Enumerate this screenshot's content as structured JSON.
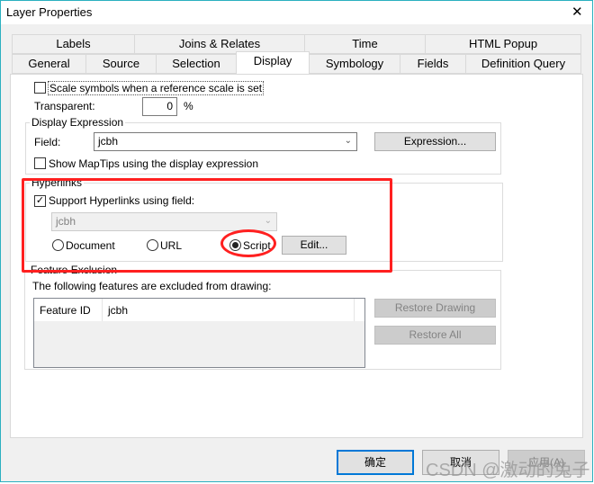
{
  "window": {
    "title": "Layer Properties",
    "close": "✕"
  },
  "tabs_row1": [
    "Labels",
    "Joins & Relates",
    "Time",
    "HTML Popup"
  ],
  "tabs_row2": [
    "General",
    "Source",
    "Selection",
    "Display",
    "Symbology",
    "Fields",
    "Definition Query"
  ],
  "active_tab": "Display",
  "display": {
    "scale_symbols": {
      "label": "Scale symbols when a reference scale is set",
      "checked": false
    },
    "transparent": {
      "label": "Transparent:",
      "value": "0",
      "unit": "%"
    },
    "display_expression": {
      "title": "Display Expression",
      "field_label": "Field:",
      "field_value": "jcbh",
      "expression_button": "Expression...",
      "maptips": {
        "label": "Show MapTips using the display expression",
        "checked": false
      }
    },
    "hyperlinks": {
      "title": "Hyperlinks",
      "support": {
        "label": "Support Hyperlinks using field:",
        "checked": true
      },
      "field_value": "jcbh",
      "options": [
        "Document",
        "URL",
        "Script"
      ],
      "selected": "Script",
      "edit_button": "Edit..."
    },
    "feature_exclusion": {
      "title": "Feature Exclusion",
      "description": "The following features are excluded from drawing:",
      "columns": [
        "Feature ID",
        "jcbh"
      ],
      "restore_drawing": "Restore Drawing",
      "restore_all": "Restore All"
    }
  },
  "footer": {
    "ok": "确定",
    "cancel": "取消",
    "apply": "应用(A)"
  },
  "watermark": "CSDN @激动的兔子",
  "colors": {
    "highlight": "#ff2020",
    "focus": "#0078d7"
  }
}
